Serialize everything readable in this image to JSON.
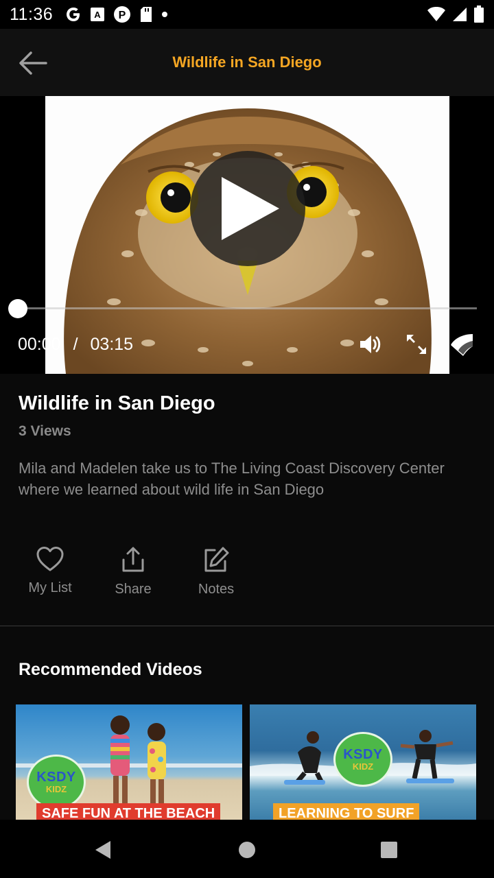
{
  "status_bar": {
    "time": "11:36",
    "left_icons": [
      "google-icon",
      "text-a-icon",
      "p-badge-icon",
      "sd-card-icon",
      "dot-icon"
    ],
    "right_icons": [
      "wifi-icon",
      "signal-icon",
      "battery-icon"
    ]
  },
  "app_bar": {
    "title": "Wildlife in San Diego",
    "title_color": "#f5a623",
    "back_icon": "arrow-left-icon"
  },
  "player": {
    "current_time": "00:00",
    "separator": "/",
    "duration": "03:15",
    "progress": 0,
    "controls": [
      "play-icon",
      "volume-icon",
      "fullscreen-icon",
      "cast-icon"
    ]
  },
  "video": {
    "title": "Wildlife in San Diego",
    "views": "3 Views",
    "description": "Mila and Madelen take us to The Living Coast Discovery Center where we learned about wild life in San Diego"
  },
  "actions": [
    {
      "label": "My List",
      "icon": "heart-icon"
    },
    {
      "label": "Share",
      "icon": "share-icon"
    },
    {
      "label": "Notes",
      "icon": "edit-icon"
    }
  ],
  "recommended": {
    "title": "Recommended Videos",
    "items": [
      {
        "caption": "SAFE FUN AT THE BEACH",
        "logo_line1": "KSDY",
        "logo_line2": "KIDZ"
      },
      {
        "caption": "LEARNING TO SURF",
        "logo_line1": "KSDY",
        "logo_line2": "KIDZ"
      }
    ]
  },
  "nav_bar": {
    "icons": [
      "nav-back-icon",
      "nav-home-icon",
      "nav-recents-icon"
    ]
  }
}
